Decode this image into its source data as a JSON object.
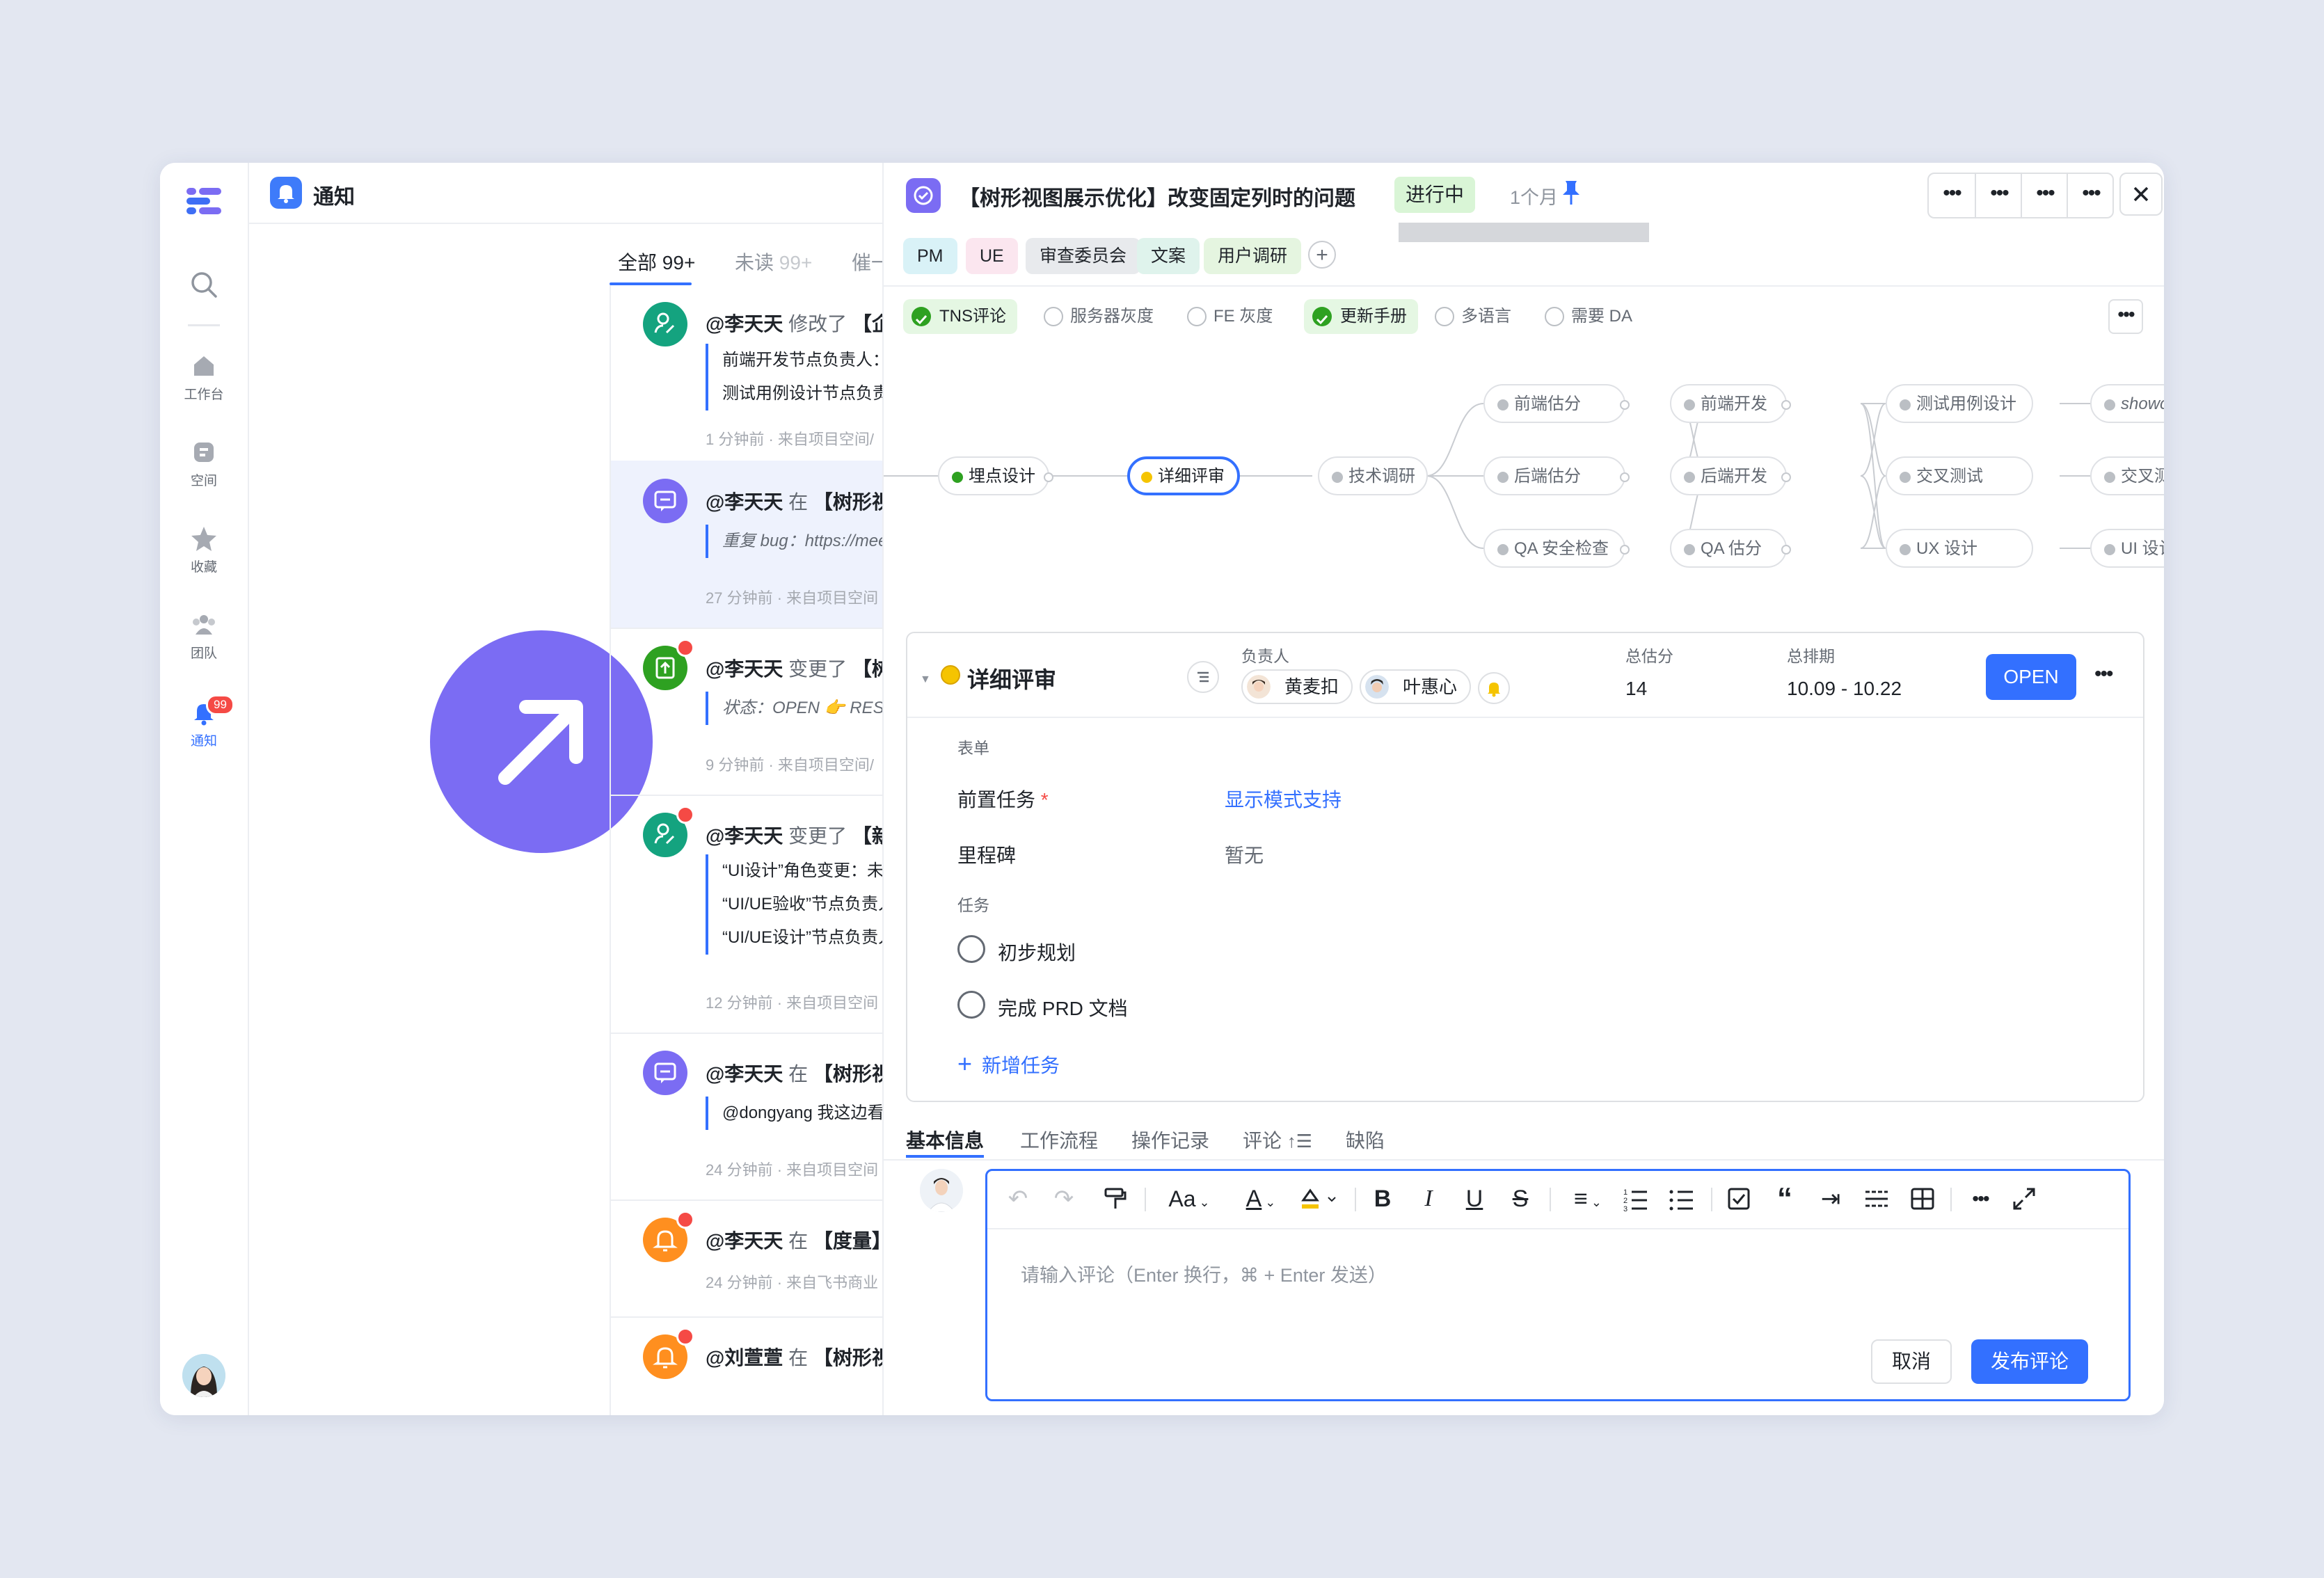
{
  "rail": {
    "items": [
      {
        "label": "工作台"
      },
      {
        "label": "空间"
      },
      {
        "label": "收藏"
      },
      {
        "label": "团队"
      },
      {
        "label": "通知",
        "badge": "99"
      }
    ]
  },
  "notifications": {
    "title": "通知",
    "tabs": [
      {
        "label": "全部",
        "count": "99+"
      },
      {
        "label": "未读",
        "count": "99+"
      },
      {
        "label": "催一"
      }
    ],
    "items": [
      {
        "actor": "@李天天",
        "verb": "修改了",
        "target": "【企业",
        "lines": [
          "前端开发节点负责人：未",
          "测试用例设计节点负责人"
        ],
        "meta": "1 分钟前 · 来自项目空间/",
        "icon": "user-edit-icon",
        "color": "#14a37f"
      },
      {
        "actor": "@李天天",
        "verb": "在",
        "target": "【树形视图",
        "lines": [
          "重复 bug：https://mee"
        ],
        "meta": "27 分钟前 · 来自项目空间",
        "icon": "comment-icon",
        "color": "#7b6cf3"
      },
      {
        "actor": "@李天天",
        "verb": "变更了",
        "target": "【树形",
        "lines": [
          "状态：OPEN 👉 RESOLV"
        ],
        "meta": "9 分钟前 · 来自项目空间/",
        "icon": "status-change-icon",
        "color": "#2ea121"
      },
      {
        "actor": "@李天天",
        "verb": "变更了",
        "target": "【新手",
        "lines": [
          "“UI设计”角色变更：未设",
          "“UI/UE验收”节点负责人",
          "“UI/UE设计”节点负责人"
        ],
        "meta": "12 分钟前 · 来自项目空间",
        "icon": "user-edit-icon",
        "color": "#14a37f"
      },
      {
        "actor": "@李天天",
        "verb": "在",
        "target": "【树形视图",
        "lines": [
          "@dongyang  我这边看E"
        ],
        "meta": "24 分钟前 · 来自项目空间",
        "icon": "comment-icon",
        "color": "#7b6cf3"
      },
      {
        "actor": "@李天天",
        "verb": "在",
        "target": "【度量】用",
        "lines": [],
        "meta": "24 分钟前 · 来自飞书商业",
        "icon": "bell-icon",
        "color": "#ff8f1f"
      },
      {
        "actor": "@刘萱萱",
        "verb": "在",
        "target": "【树形视图",
        "lines": [],
        "meta": "",
        "icon": "bell-icon",
        "color": "#ff8f1f"
      }
    ]
  },
  "detail": {
    "title": "【树形视图展示优化】改变固定列时的问题",
    "status": "进行中",
    "duration": "1个月",
    "tags": [
      "PM",
      "UE",
      "审查委员会",
      "文案",
      "用户调研"
    ],
    "checks": [
      {
        "label": "TNS评论",
        "checked": true
      },
      {
        "label": "服务器灰度",
        "checked": false
      },
      {
        "label": "FE 灰度",
        "checked": false
      },
      {
        "label": "更新手册",
        "checked": true
      },
      {
        "label": "多语言",
        "checked": false
      },
      {
        "label": "需要 DA",
        "checked": false
      }
    ],
    "flow_nodes": {
      "n1": "埋点设计",
      "n2": "详细评审",
      "n3": "技术调研",
      "n4": "前端估分",
      "n5": "后端估分",
      "n6": "QA 安全检查",
      "n7": "前端开发",
      "n8": "后端开发",
      "n9": "QA 估分",
      "n10": "测试用例设计",
      "n11": "交叉测试",
      "n12": "UX 设计",
      "n13": "showcase",
      "n14": "交叉测试",
      "n15": "UI 设计"
    },
    "card": {
      "title": "详细评审",
      "owner_label": "负责人",
      "owners": [
        "黄麦扣",
        "叶惠心"
      ],
      "estimate_label": "总估分",
      "estimate": "14",
      "schedule_label": "总排期",
      "schedule": "10.09 - 10.22",
      "open_label": "OPEN",
      "form_label": "表单",
      "predecessor_label": "前置任务",
      "predecessor_value": "显示模式支持",
      "milestone_label": "里程碑",
      "milestone_value": "暂无",
      "tasks_label": "任务",
      "tasks": [
        "初步规划",
        "完成 PRD 文档"
      ],
      "add_task": "新增任务"
    },
    "bottom_tabs": [
      "基本信息",
      "工作流程",
      "操作记录",
      "评论",
      "缺陷"
    ],
    "comment": {
      "placeholder": "请输入评论（Enter 换行，⌘ + Enter 发送）",
      "cancel": "取消",
      "publish": "发布评论"
    }
  },
  "colors": {
    "accent": "#3370ff",
    "status_green_bg": "#d9f5d6",
    "purple": "#7b6cf3"
  }
}
